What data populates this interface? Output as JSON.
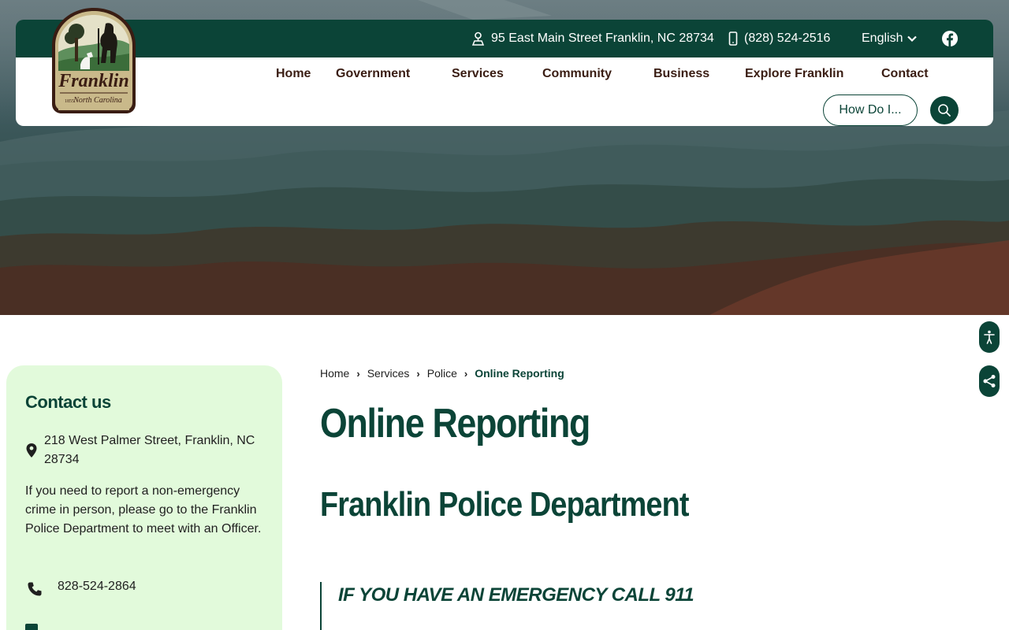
{
  "header": {
    "address": "95 East Main Street Franklin, NC 28734",
    "phone": "(828) 524-2516",
    "language": "English",
    "logo": {
      "text_main": "Franklin",
      "text_sub": "North Carolina",
      "year": "1855"
    }
  },
  "nav": {
    "items": [
      "Home",
      "Government",
      "Services",
      "Community",
      "Business",
      "Explore Franklin",
      "Contact"
    ],
    "how_do_i": "How Do I...",
    "search_icon": "search-icon"
  },
  "sidebar": {
    "title": "Contact us",
    "address": "218 West Palmer Street, Franklin, NC 28734",
    "note": "If you need to report a non-emergency crime in person, please go to the Franklin Police Department to meet with an Officer.",
    "phone": "828-524-2864"
  },
  "breadcrumb": {
    "items": [
      "Home",
      "Services",
      "Police"
    ],
    "current": "Online Reporting"
  },
  "main": {
    "title": "Online Reporting",
    "subtitle": "Franklin Police Department",
    "callout": "IF YOU HAVE AN EMERGENCY CALL 911"
  },
  "colors": {
    "brand": "#0b4437",
    "nav_text": "#3a1d13",
    "sidebar_bg": "#e2fadb"
  },
  "floating_buttons": [
    "accessibility-icon",
    "share-icon"
  ]
}
